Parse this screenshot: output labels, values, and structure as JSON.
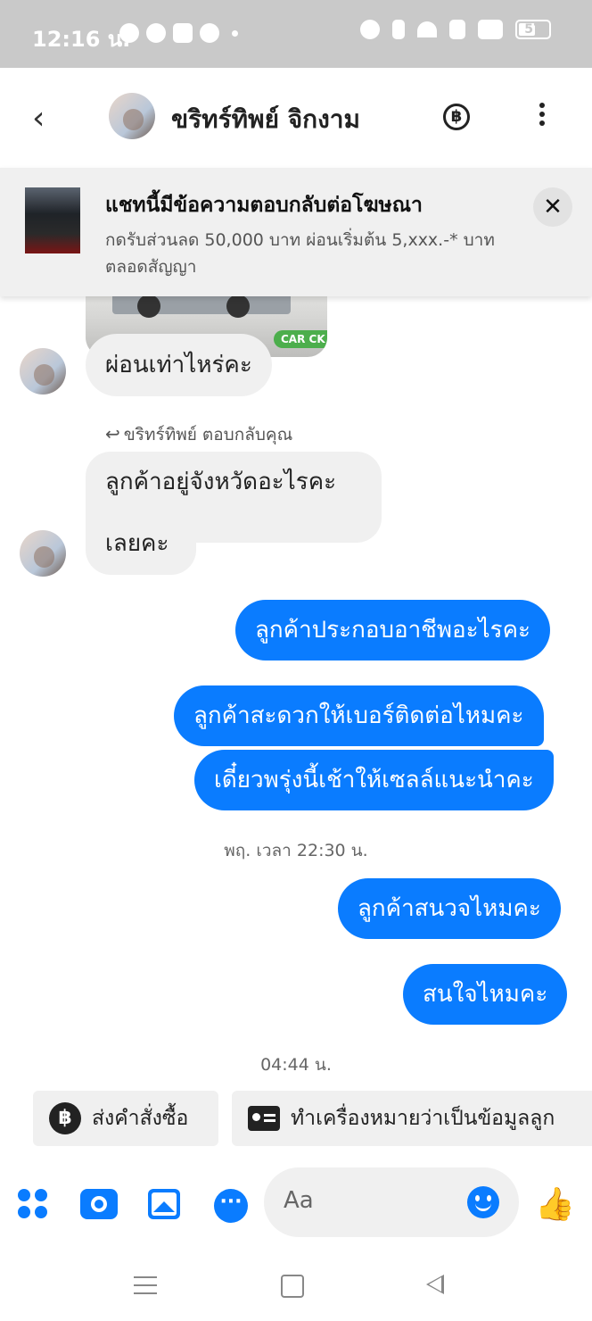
{
  "status_bar": {
    "time": "12:16 น.",
    "battery": "57",
    "battery_level": 0.57,
    "icons": [
      "messenger-icon",
      "line-icon",
      "youtube-icon",
      "google-icon",
      "alarm-icon",
      "vibrate-icon",
      "wifi-icon",
      "volte-icon",
      "signal-icon",
      "battery-icon"
    ]
  },
  "header": {
    "contact_name": "ขริทร์ทิพย์ จิกงาม",
    "back_icon": "chevron-left-icon",
    "payment_icon": "baht-icon",
    "menu_icon": "more-vertical-icon"
  },
  "ad_banner": {
    "title": "แชทนี้มีข้อความตอบกลับต่อโฆษณา",
    "subtitle": "กดรับส่วนลด 50,000 บาท ผ่อนเริ่มต้น 5,xxx.-* บาท ตลอดสัญญา",
    "close_label": "✕"
  },
  "messages": {
    "m1": "ผ่อนเท่าไหร่คะ",
    "reply_note": "ขริทร์ทิพย์ ตอบกลับคุณ",
    "m2_line1": "ลูกค้าอยู่จังหวัดอะไรคะ",
    "m2_line2": "เลยคะ",
    "m3": "ลูกค้าประกอบอาชีพอะไรคะ",
    "m4": "ลูกค้าสะดวกให้เบอร์ติดต่อไหมคะ",
    "m5": "เดี๋ยวพรุ่งนี้เช้าให้เซลล์แนะนำคะ",
    "ts1": "พฤ. เวลา 22:30 น.",
    "m6": "ลูกค้าสนวจไหมคะ",
    "m7": "สนใจไหมคะ",
    "ts2": "04:44 น.",
    "car_tag": "CAR CK"
  },
  "quick_actions": {
    "send_order": "ส่งคำสั่งซื้อ",
    "mark_lead": "ทำเครื่องหมายว่าเป็นข้อมูลลูก"
  },
  "composer": {
    "placeholder": "Aa",
    "icons": [
      "apps-icon",
      "camera-icon",
      "image-icon",
      "chat-bubble-icon",
      "emoji-icon",
      "thumbs-up-icon"
    ]
  },
  "colors": {
    "accent": "#0a7cff",
    "incoming_bubble": "#f0f0f0",
    "status_bar": "#c9c9c9"
  }
}
